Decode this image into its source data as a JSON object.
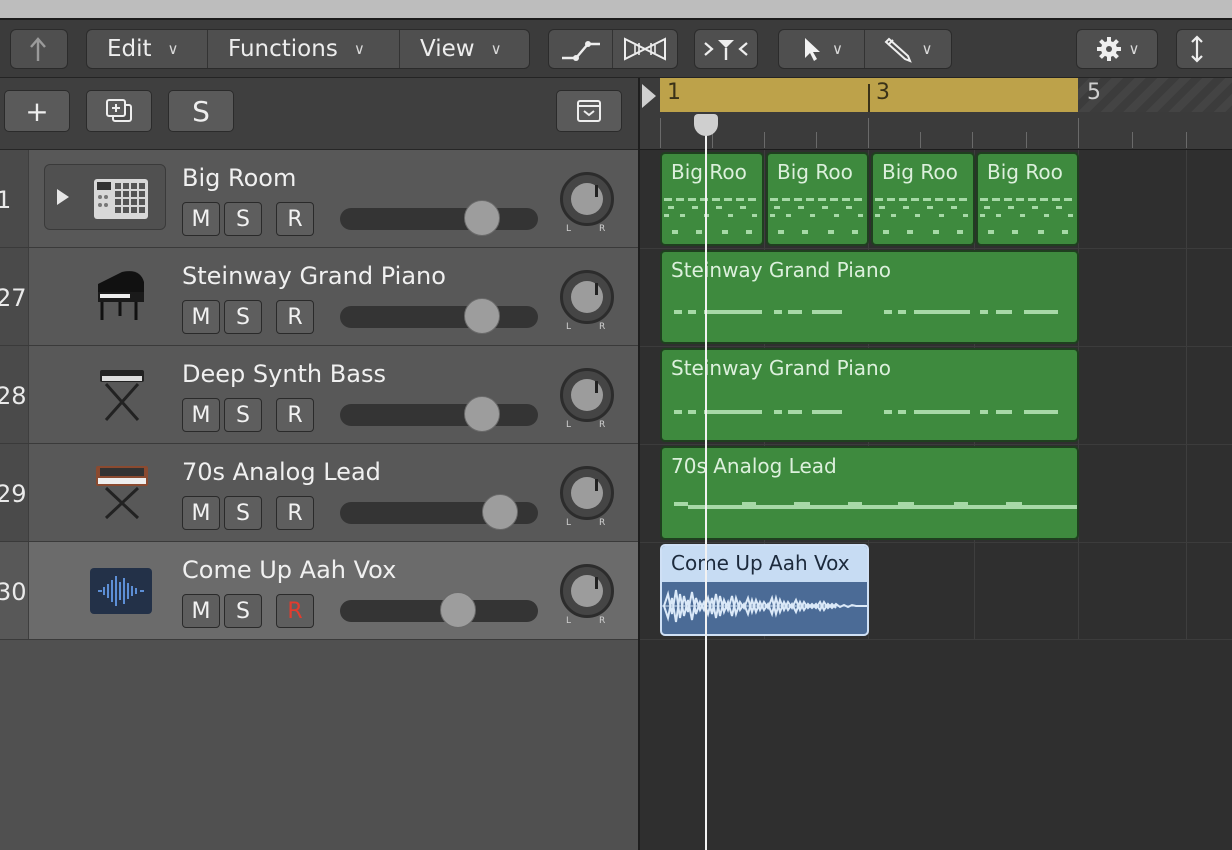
{
  "toolbar": {
    "back_icon": "back-arrow-icon",
    "menus": [
      {
        "label": "Edit"
      },
      {
        "label": "Functions"
      },
      {
        "label": "View"
      }
    ]
  },
  "track_header": {
    "add_label": "+",
    "solo_label": "S"
  },
  "ruler": {
    "bars": [
      "1",
      "3",
      "5"
    ]
  },
  "tracks": [
    {
      "number": "1",
      "name": "Big Room",
      "mute": "M",
      "solo": "S",
      "record": "R",
      "volume_fraction": 0.72,
      "pan_left": "L",
      "pan_right": "R",
      "icon": "drum-machine-icon"
    },
    {
      "number": "27",
      "name": "Steinway Grand Piano",
      "mute": "M",
      "solo": "S",
      "record": "R",
      "volume_fraction": 0.72,
      "pan_left": "L",
      "pan_right": "R",
      "icon": "grand-piano-icon"
    },
    {
      "number": "28",
      "name": "Deep Synth Bass",
      "mute": "M",
      "solo": "S",
      "record": "R",
      "volume_fraction": 0.72,
      "pan_left": "L",
      "pan_right": "R",
      "icon": "synth-keyboard-icon"
    },
    {
      "number": "29",
      "name": "70s Analog Lead",
      "mute": "M",
      "solo": "S",
      "record": "R",
      "volume_fraction": 0.81,
      "pan_left": "L",
      "pan_right": "R",
      "icon": "analog-synth-icon"
    },
    {
      "number": "30",
      "name": "Come Up Aah Vox",
      "mute": "M",
      "solo": "S",
      "record": "R",
      "volume_fraction": 0.6,
      "pan_left": "L",
      "pan_right": "R",
      "icon": "audio-waveform-icon"
    }
  ],
  "regions": {
    "big_room": [
      "Big Roo",
      "Big Roo",
      "Big Roo",
      "Big Roo"
    ],
    "piano": "Steinway Grand Piano",
    "bass": "Steinway Grand Piano",
    "lead": "70s Analog Lead",
    "vox": "Come Up Aah Vox"
  },
  "colors": {
    "midi_region": "#3e8a3e",
    "audio_region": "#4b6b96",
    "cycle": "#bda24a",
    "record_active": "#e23c2e"
  }
}
